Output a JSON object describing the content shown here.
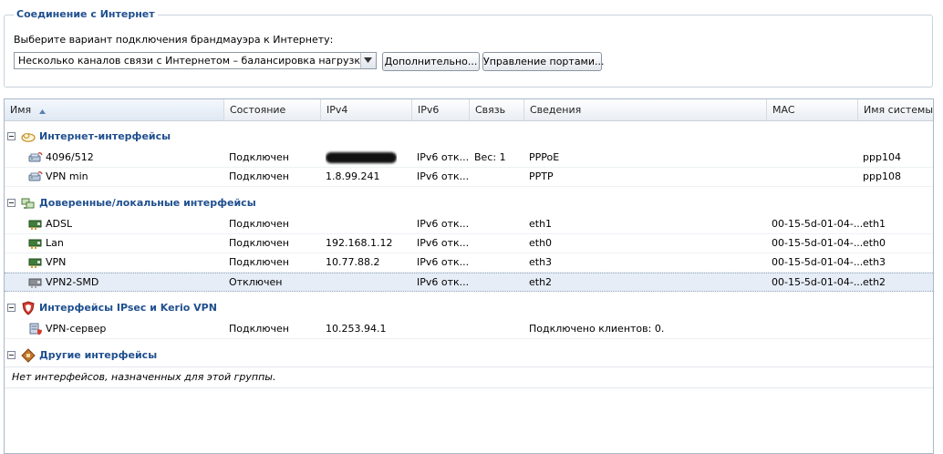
{
  "connection": {
    "legend": "Соединение с Интернет",
    "prompt": "Выберите вариант подключения брандмауэра к Интернету:",
    "selected_mode": "Несколько каналов связи с Интернетом – балансировка нагрузки",
    "advanced_button": "Дополнительно...",
    "ports_button": "Управление портами..."
  },
  "table": {
    "columns": [
      "Имя",
      "Состояние",
      "IPv4",
      "IPv6",
      "Связь",
      "Сведения",
      "MAC",
      "Имя системы"
    ],
    "sorted_column": "Имя",
    "groups": [
      {
        "title": "Интернет-интерфейсы",
        "icon": "cloud-icon",
        "rows": [
          {
            "name": "4096/512",
            "icon": "modem-icon",
            "state": "Подключен",
            "ipv4": "",
            "ipv4_redacted": true,
            "ipv6": "IPv6 отк...",
            "link": "Вес: 1",
            "info": "PPPoE",
            "mac": "",
            "sys": "ppp104"
          },
          {
            "name": "VPN min",
            "icon": "modem-icon",
            "state": "Подключен",
            "ipv4": "1.8.99.241",
            "ipv6": "IPv6 отк...",
            "link": "",
            "info": "PPTP",
            "mac": "",
            "sys": "ppp108"
          }
        ]
      },
      {
        "title": "Доверенные/локальные интерфейсы",
        "icon": "network-computers-icon",
        "rows": [
          {
            "name": "ADSL",
            "icon": "network-card-icon",
            "state": "Подключен",
            "ipv4": "",
            "ipv6": "IPv6 отк...",
            "link": "",
            "info": "eth1",
            "mac": "00-15-5d-01-04-...",
            "sys": "eth1"
          },
          {
            "name": "Lan",
            "icon": "network-card-icon",
            "state": "Подключен",
            "ipv4": "192.168.1.12",
            "ipv6": "IPv6 отк...",
            "link": "",
            "info": "eth0",
            "mac": "00-15-5d-01-04-...",
            "sys": "eth0"
          },
          {
            "name": "VPN",
            "icon": "network-card-icon",
            "state": "Подключен",
            "ipv4": "10.77.88.2",
            "ipv6": "IPv6 отк...",
            "link": "",
            "info": "eth3",
            "mac": "00-15-5d-01-04-...",
            "sys": "eth3"
          },
          {
            "name": "VPN2-SMD",
            "icon": "network-card-disabled-icon",
            "state": "Отключен",
            "ipv4": "",
            "ipv6": "IPv6 отк...",
            "link": "",
            "info": "eth2",
            "mac": "00-15-5d-01-04-...",
            "sys": "eth2",
            "selected": true
          }
        ]
      },
      {
        "title": "Интерфейсы IPsec и Kerio VPN",
        "icon": "shield-icon",
        "rows": [
          {
            "name": "VPN-сервер",
            "icon": "vpn-server-icon",
            "state": "Подключен",
            "ipv4": "10.253.94.1",
            "ipv6": "",
            "link": "",
            "info": "Подключено клиентов: 0.",
            "mac": "",
            "sys": ""
          }
        ]
      },
      {
        "title": "Другие интерфейсы",
        "icon": "other-interfaces-icon",
        "rows": []
      }
    ],
    "empty_group_text": "Нет интерфейсов, назначенных для этой группы."
  },
  "colors": {
    "group_title": "#1f4f8f",
    "selected_row": "#e6edf6"
  }
}
